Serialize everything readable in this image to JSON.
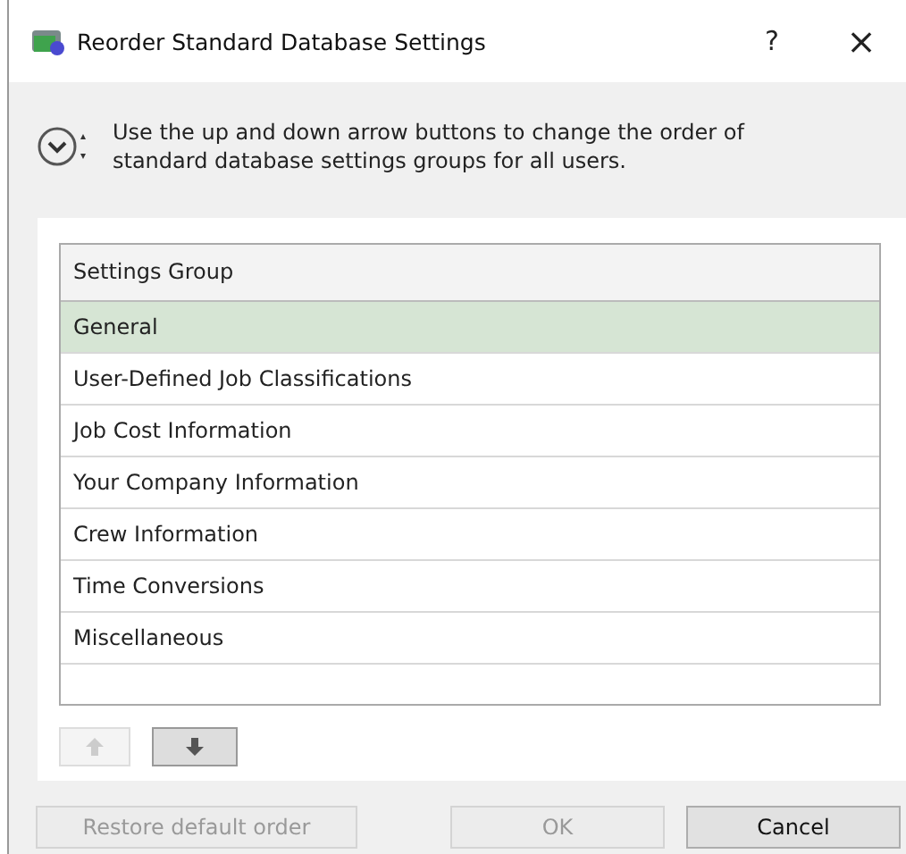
{
  "window": {
    "title": "Reorder Standard Database Settings",
    "help": "?",
    "close": "×"
  },
  "instructions": "Use the up and down arrow buttons to change the order of standard database settings groups for all users.",
  "table": {
    "columns": [
      "Settings Group"
    ],
    "rows": [
      {
        "label": "General",
        "selected": true
      },
      {
        "label": "User-Defined Job Classifications",
        "selected": false
      },
      {
        "label": "Job Cost Information",
        "selected": false
      },
      {
        "label": "Your Company Information",
        "selected": false
      },
      {
        "label": "Crew Information",
        "selected": false
      },
      {
        "label": "Time Conversions",
        "selected": false
      },
      {
        "label": "Miscellaneous",
        "selected": false
      }
    ]
  },
  "move_buttons": [
    {
      "kind": "up",
      "disabled": true
    },
    {
      "kind": "down",
      "disabled": false
    }
  ],
  "buttons": [
    {
      "label": "Restore default order",
      "disabled": true
    },
    {
      "label": "OK",
      "disabled": true
    },
    {
      "label": "Cancel",
      "disabled": false
    }
  ]
}
